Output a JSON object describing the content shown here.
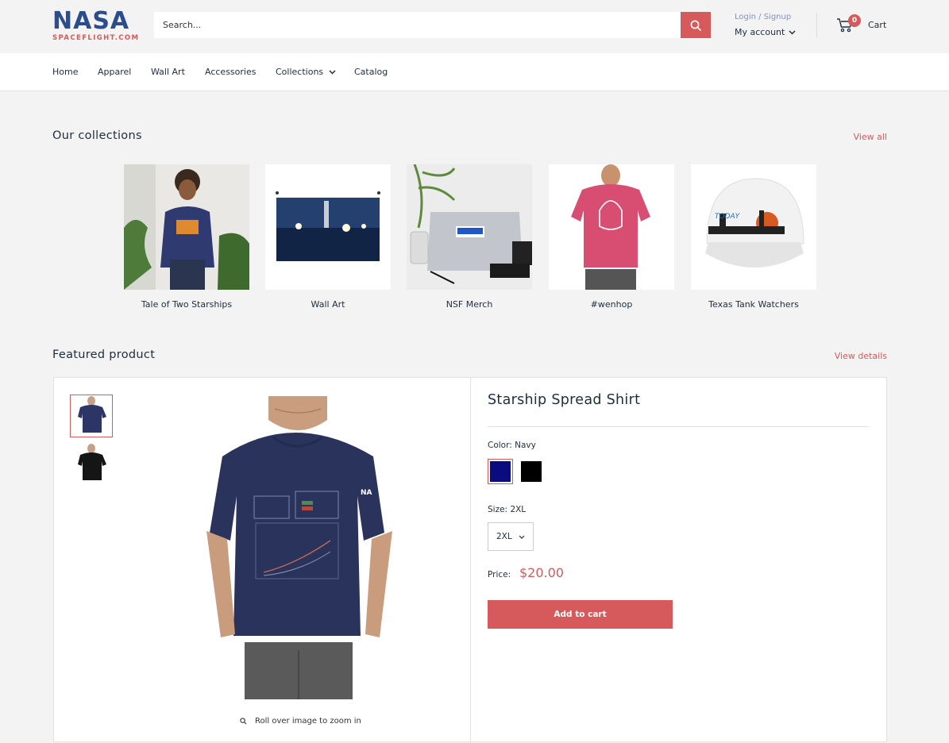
{
  "logo": {
    "word": "NASA",
    "sub": "SPACEFLIGHT.COM"
  },
  "search": {
    "placeholder": "Search..."
  },
  "account": {
    "login": "Login / Signup",
    "my_account": "My account"
  },
  "cart": {
    "count": "0",
    "label": "Cart"
  },
  "nav": {
    "home": "Home",
    "apparel": "Apparel",
    "wall_art": "Wall Art",
    "accessories": "Accessories",
    "collections": "Collections",
    "catalog": "Catalog"
  },
  "collections_section": {
    "title": "Our collections",
    "view_all": "View all",
    "items": [
      {
        "label": "Tale of Two Starships"
      },
      {
        "label": "Wall Art"
      },
      {
        "label": "NSF Merch"
      },
      {
        "label": "#wenhop"
      },
      {
        "label": "Texas Tank Watchers"
      }
    ]
  },
  "featured": {
    "title": "Featured product",
    "view_details": "View details",
    "product_name": "Starship Spread Shirt",
    "color_label": "Color:",
    "color_value": "Navy",
    "colors": [
      "#0b0b80",
      "#000000"
    ],
    "size_label": "Size:",
    "size_value": "2XL",
    "size_selected": "2XL",
    "price_label": "Price:",
    "price": "$20.00",
    "add_to_cart": "Add to cart",
    "zoom_hint": "Roll over image to zoom in"
  },
  "colors": {
    "accent": "#d65a5c",
    "brand_blue": "#2b4d8c",
    "text": "#1e2d3d"
  }
}
